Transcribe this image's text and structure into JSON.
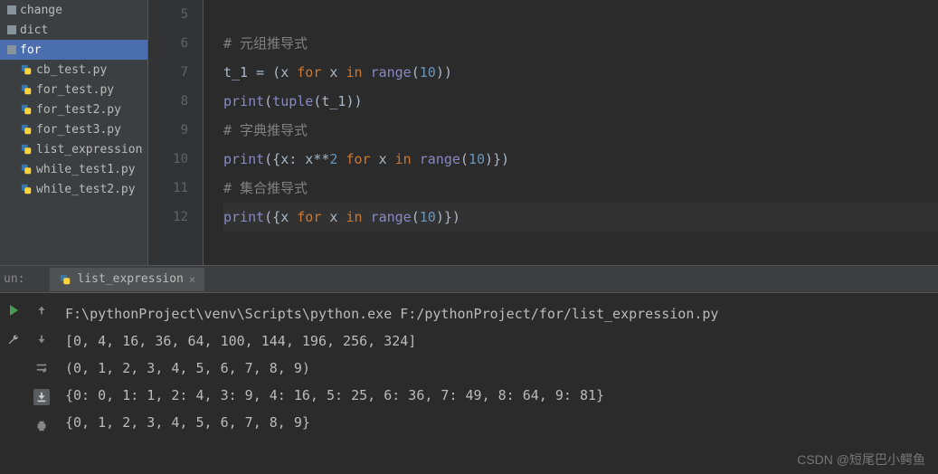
{
  "sidebar": {
    "items": [
      {
        "label": "change",
        "type": "folder"
      },
      {
        "label": "dict",
        "type": "folder"
      },
      {
        "label": "for",
        "type": "folder",
        "selected": true
      },
      {
        "label": "cb_test.py",
        "type": "py",
        "indent": 1
      },
      {
        "label": "for_test.py",
        "type": "py",
        "indent": 1
      },
      {
        "label": "for_test2.py",
        "type": "py",
        "indent": 1
      },
      {
        "label": "for_test3.py",
        "type": "py",
        "indent": 1
      },
      {
        "label": "list_expression",
        "type": "py",
        "indent": 1,
        "clipped": true
      },
      {
        "label": "while_test1.py",
        "type": "py",
        "indent": 1,
        "clipped": true
      },
      {
        "label": "while_test2.py",
        "type": "py",
        "indent": 1,
        "clipped": true
      }
    ]
  },
  "editor": {
    "lines": [
      {
        "num": "5",
        "tokens": []
      },
      {
        "num": "6",
        "tokens": [
          {
            "t": "# 元组推导式",
            "c": "comment"
          }
        ]
      },
      {
        "num": "7",
        "tokens": [
          {
            "t": "t_1 = (x ",
            "c": "text"
          },
          {
            "t": "for ",
            "c": "keyword"
          },
          {
            "t": "x ",
            "c": "text"
          },
          {
            "t": "in ",
            "c": "keyword"
          },
          {
            "t": "range",
            "c": "builtin"
          },
          {
            "t": "(",
            "c": "text"
          },
          {
            "t": "10",
            "c": "number"
          },
          {
            "t": "))",
            "c": "text"
          }
        ]
      },
      {
        "num": "8",
        "tokens": [
          {
            "t": "print",
            "c": "builtin"
          },
          {
            "t": "(",
            "c": "text"
          },
          {
            "t": "tuple",
            "c": "builtin"
          },
          {
            "t": "(t_1))",
            "c": "text"
          }
        ]
      },
      {
        "num": "9",
        "tokens": [
          {
            "t": "# 字典推导式",
            "c": "comment"
          }
        ]
      },
      {
        "num": "10",
        "tokens": [
          {
            "t": "print",
            "c": "builtin"
          },
          {
            "t": "({x: x**",
            "c": "text"
          },
          {
            "t": "2 ",
            "c": "number"
          },
          {
            "t": "for ",
            "c": "keyword"
          },
          {
            "t": "x ",
            "c": "text"
          },
          {
            "t": "in ",
            "c": "keyword"
          },
          {
            "t": "range",
            "c": "builtin"
          },
          {
            "t": "(",
            "c": "text"
          },
          {
            "t": "10",
            "c": "number"
          },
          {
            "t": ")})",
            "c": "text"
          }
        ]
      },
      {
        "num": "11",
        "tokens": [
          {
            "t": "# 集合推导式",
            "c": "comment"
          }
        ]
      },
      {
        "num": "12",
        "tokens": [
          {
            "t": "print",
            "c": "builtin"
          },
          {
            "t": "({x ",
            "c": "text"
          },
          {
            "t": "for ",
            "c": "keyword"
          },
          {
            "t": "x ",
            "c": "text"
          },
          {
            "t": "in ",
            "c": "keyword"
          },
          {
            "t": "range",
            "c": "builtin"
          },
          {
            "t": "(",
            "c": "text"
          },
          {
            "t": "10",
            "c": "number"
          },
          {
            "t": ")})",
            "c": "text"
          }
        ],
        "current": true
      }
    ]
  },
  "run": {
    "label": "un:",
    "tab_label": "list_expression",
    "output": [
      "F:\\pythonProject\\venv\\Scripts\\python.exe F:/pythonProject/for/list_expression.py",
      "[0, 4, 16, 36, 64, 100, 144, 196, 256, 324]",
      "(0, 1, 2, 3, 4, 5, 6, 7, 8, 9)",
      "{0: 0, 1: 1, 2: 4, 3: 9, 4: 16, 5: 25, 6: 36, 7: 49, 8: 64, 9: 81}",
      "{0, 1, 2, 3, 4, 5, 6, 7, 8, 9}"
    ]
  },
  "watermark": "CSDN @短尾巴小鳄鱼"
}
